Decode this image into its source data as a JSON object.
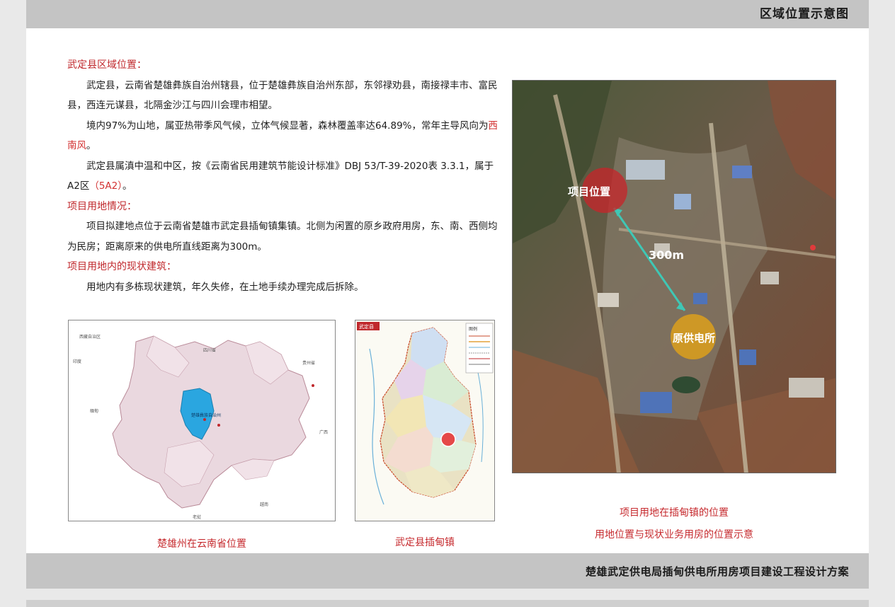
{
  "header": {
    "title": "区域位置示意图"
  },
  "footer": {
    "title": "楚雄武定供电局插甸供电所用房项目建设工程设计方案"
  },
  "section1": {
    "heading": "武定县区域位置：",
    "p1": "武定县，云南省楚雄彝族自治州辖县，位于楚雄彝族自治州东部，东邻禄劝县，南接禄丰市、富民县，西连元谋县，北隔金沙江与四川会理市相望。",
    "p2_before": "境内97%为山地，属亚热带季风气候，立体气候显著，森林覆盖率达64.89%，常年主导风向为",
    "p2_red": "西南风",
    "p2_after": "。",
    "p3_before": "武定县属滇中温和中区，按《云南省民用建筑节能设计标准》DBJ 53/T-39-2020表 3.3.1，属于A2区",
    "p3_red": "（5A2）",
    "p3_after": "。"
  },
  "section2": {
    "heading": "项目用地情况：",
    "p1": "项目拟建地点位于云南省楚雄市武定县插甸镇集镇。北侧为闲置的原乡政府用房，东、南、西侧均为民房；距离原来的供电所直线距离为300m。"
  },
  "section3": {
    "heading": "项目用地内的现状建筑：",
    "p1": "用地内有多栋现状建筑，年久失修，在土地手续办理完成后拆除。"
  },
  "map1": {
    "caption": "楚雄州在云南省位置",
    "labels": {
      "sichuan": "四川省",
      "guizhou": "贵州省",
      "guangxi": "广西",
      "highlight": "楚雄彝族自治州",
      "xizang": "西藏自治区",
      "vietnam": "越南",
      "laos": "老挝",
      "myanmar": "缅甸",
      "yinyang": "印度"
    }
  },
  "map2": {
    "caption": "武定县插甸镇",
    "tag": "武定县",
    "legend": "图例"
  },
  "aerial": {
    "caption1": "项目用地在插甸镇的位置",
    "caption2": "用地位置与现状业务用房的位置示意",
    "project_label": "项目位置",
    "station_label": "原供电所",
    "distance": "300m"
  },
  "colors": {
    "accent_red": "#c0282c",
    "bar_gray": "#c4c4c4",
    "highlight_blue": "#2aa6e0",
    "line_teal": "#3fc7b5"
  }
}
